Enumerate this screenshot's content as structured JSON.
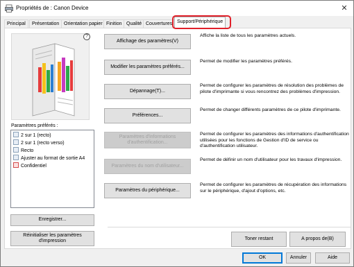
{
  "window": {
    "title": "Propriétés de : Canon Device",
    "close_glyph": "✕"
  },
  "tabs": [
    {
      "label": "Principal"
    },
    {
      "label": "Présentation"
    },
    {
      "label": "Orientation papier"
    },
    {
      "label": "Finition"
    },
    {
      "label": "Qualité"
    },
    {
      "label": "Couvertures"
    },
    {
      "label": "Support/Périphérique"
    }
  ],
  "active_tab": "Support/Périphérique",
  "highlight_color": "#e0202a",
  "preview": {
    "help_glyph": "?"
  },
  "favorites": {
    "label": "Paramètres préférés :",
    "items": [
      {
        "label": "2 sur 1 (recto)",
        "icon": "page-icon"
      },
      {
        "label": "2 sur 1 (recto verso)",
        "icon": "page-icon"
      },
      {
        "label": "Recto",
        "icon": "page-icon"
      },
      {
        "label": "Ajuster au format de sortie A4",
        "icon": "page-icon"
      },
      {
        "label": "Confidentiel",
        "icon": "confidential-icon"
      }
    ],
    "save_button": "Enregistrer...",
    "reset_button": "Réinitialiser les paramètres d'impression"
  },
  "actions": [
    {
      "button": "Affichage des paramètres(V)",
      "enabled": true,
      "description": "Affiche la liste de tous les paramètres actuels."
    },
    {
      "button": "Modifier les paramètres préférés...",
      "enabled": true,
      "description": "Permet de modifier les paramètres préférés."
    },
    {
      "button": "Dépannage(T)...",
      "enabled": true,
      "description": "Permet de configurer les paramètres de résolution des problèmes de pilote d'imprimante si vous rencontrez des problèmes d'impression."
    },
    {
      "button": "Préférences...",
      "enabled": true,
      "description": "Permet de changer différents paramètres de ce pilote d'imprimante."
    },
    {
      "button": "Paramètres d'informations d'authentification...",
      "enabled": false,
      "description": "Permet de configurer les paramètres des informations d'authentification utilisées pour les fonctions de Gestion d'ID de service ou d'authentification utilisateur."
    },
    {
      "button": "Paramètres du nom d'utilisateur...",
      "enabled": false,
      "description": "Permet de définir un nom d'utilisateur pour les travaux d'impression."
    },
    {
      "button": "Paramètres du périphérique...",
      "enabled": true,
      "description": "Permet de configurer les paramètres de récupération des informations sur le périphérique, d'ajout d'options, etc."
    }
  ],
  "bottom_panel": {
    "restore_button": "Toner restant",
    "about_button": "A propos de(B)"
  },
  "footer": {
    "ok_button": "OK",
    "cancel_button": "Annuler",
    "help_button": "Aide"
  }
}
